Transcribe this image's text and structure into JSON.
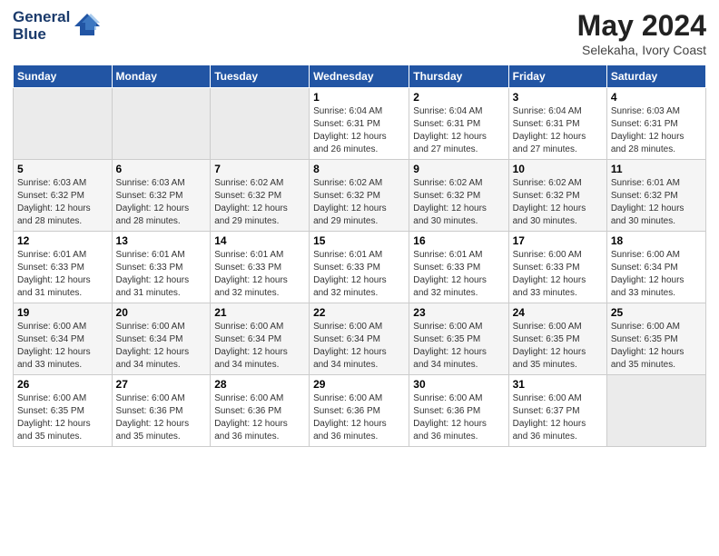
{
  "header": {
    "logo_line1": "General",
    "logo_line2": "Blue",
    "month_year": "May 2024",
    "location": "Selekaha, Ivory Coast"
  },
  "weekdays": [
    "Sunday",
    "Monday",
    "Tuesday",
    "Wednesday",
    "Thursday",
    "Friday",
    "Saturday"
  ],
  "weeks": [
    [
      {
        "day": "",
        "info": ""
      },
      {
        "day": "",
        "info": ""
      },
      {
        "day": "",
        "info": ""
      },
      {
        "day": "1",
        "info": "Sunrise: 6:04 AM\nSunset: 6:31 PM\nDaylight: 12 hours\nand 26 minutes."
      },
      {
        "day": "2",
        "info": "Sunrise: 6:04 AM\nSunset: 6:31 PM\nDaylight: 12 hours\nand 27 minutes."
      },
      {
        "day": "3",
        "info": "Sunrise: 6:04 AM\nSunset: 6:31 PM\nDaylight: 12 hours\nand 27 minutes."
      },
      {
        "day": "4",
        "info": "Sunrise: 6:03 AM\nSunset: 6:31 PM\nDaylight: 12 hours\nand 28 minutes."
      }
    ],
    [
      {
        "day": "5",
        "info": "Sunrise: 6:03 AM\nSunset: 6:32 PM\nDaylight: 12 hours\nand 28 minutes."
      },
      {
        "day": "6",
        "info": "Sunrise: 6:03 AM\nSunset: 6:32 PM\nDaylight: 12 hours\nand 28 minutes."
      },
      {
        "day": "7",
        "info": "Sunrise: 6:02 AM\nSunset: 6:32 PM\nDaylight: 12 hours\nand 29 minutes."
      },
      {
        "day": "8",
        "info": "Sunrise: 6:02 AM\nSunset: 6:32 PM\nDaylight: 12 hours\nand 29 minutes."
      },
      {
        "day": "9",
        "info": "Sunrise: 6:02 AM\nSunset: 6:32 PM\nDaylight: 12 hours\nand 30 minutes."
      },
      {
        "day": "10",
        "info": "Sunrise: 6:02 AM\nSunset: 6:32 PM\nDaylight: 12 hours\nand 30 minutes."
      },
      {
        "day": "11",
        "info": "Sunrise: 6:01 AM\nSunset: 6:32 PM\nDaylight: 12 hours\nand 30 minutes."
      }
    ],
    [
      {
        "day": "12",
        "info": "Sunrise: 6:01 AM\nSunset: 6:33 PM\nDaylight: 12 hours\nand 31 minutes."
      },
      {
        "day": "13",
        "info": "Sunrise: 6:01 AM\nSunset: 6:33 PM\nDaylight: 12 hours\nand 31 minutes."
      },
      {
        "day": "14",
        "info": "Sunrise: 6:01 AM\nSunset: 6:33 PM\nDaylight: 12 hours\nand 32 minutes."
      },
      {
        "day": "15",
        "info": "Sunrise: 6:01 AM\nSunset: 6:33 PM\nDaylight: 12 hours\nand 32 minutes."
      },
      {
        "day": "16",
        "info": "Sunrise: 6:01 AM\nSunset: 6:33 PM\nDaylight: 12 hours\nand 32 minutes."
      },
      {
        "day": "17",
        "info": "Sunrise: 6:00 AM\nSunset: 6:33 PM\nDaylight: 12 hours\nand 33 minutes."
      },
      {
        "day": "18",
        "info": "Sunrise: 6:00 AM\nSunset: 6:34 PM\nDaylight: 12 hours\nand 33 minutes."
      }
    ],
    [
      {
        "day": "19",
        "info": "Sunrise: 6:00 AM\nSunset: 6:34 PM\nDaylight: 12 hours\nand 33 minutes."
      },
      {
        "day": "20",
        "info": "Sunrise: 6:00 AM\nSunset: 6:34 PM\nDaylight: 12 hours\nand 34 minutes."
      },
      {
        "day": "21",
        "info": "Sunrise: 6:00 AM\nSunset: 6:34 PM\nDaylight: 12 hours\nand 34 minutes."
      },
      {
        "day": "22",
        "info": "Sunrise: 6:00 AM\nSunset: 6:34 PM\nDaylight: 12 hours\nand 34 minutes."
      },
      {
        "day": "23",
        "info": "Sunrise: 6:00 AM\nSunset: 6:35 PM\nDaylight: 12 hours\nand 34 minutes."
      },
      {
        "day": "24",
        "info": "Sunrise: 6:00 AM\nSunset: 6:35 PM\nDaylight: 12 hours\nand 35 minutes."
      },
      {
        "day": "25",
        "info": "Sunrise: 6:00 AM\nSunset: 6:35 PM\nDaylight: 12 hours\nand 35 minutes."
      }
    ],
    [
      {
        "day": "26",
        "info": "Sunrise: 6:00 AM\nSunset: 6:35 PM\nDaylight: 12 hours\nand 35 minutes."
      },
      {
        "day": "27",
        "info": "Sunrise: 6:00 AM\nSunset: 6:36 PM\nDaylight: 12 hours\nand 35 minutes."
      },
      {
        "day": "28",
        "info": "Sunrise: 6:00 AM\nSunset: 6:36 PM\nDaylight: 12 hours\nand 36 minutes."
      },
      {
        "day": "29",
        "info": "Sunrise: 6:00 AM\nSunset: 6:36 PM\nDaylight: 12 hours\nand 36 minutes."
      },
      {
        "day": "30",
        "info": "Sunrise: 6:00 AM\nSunset: 6:36 PM\nDaylight: 12 hours\nand 36 minutes."
      },
      {
        "day": "31",
        "info": "Sunrise: 6:00 AM\nSunset: 6:37 PM\nDaylight: 12 hours\nand 36 minutes."
      },
      {
        "day": "",
        "info": ""
      }
    ]
  ]
}
